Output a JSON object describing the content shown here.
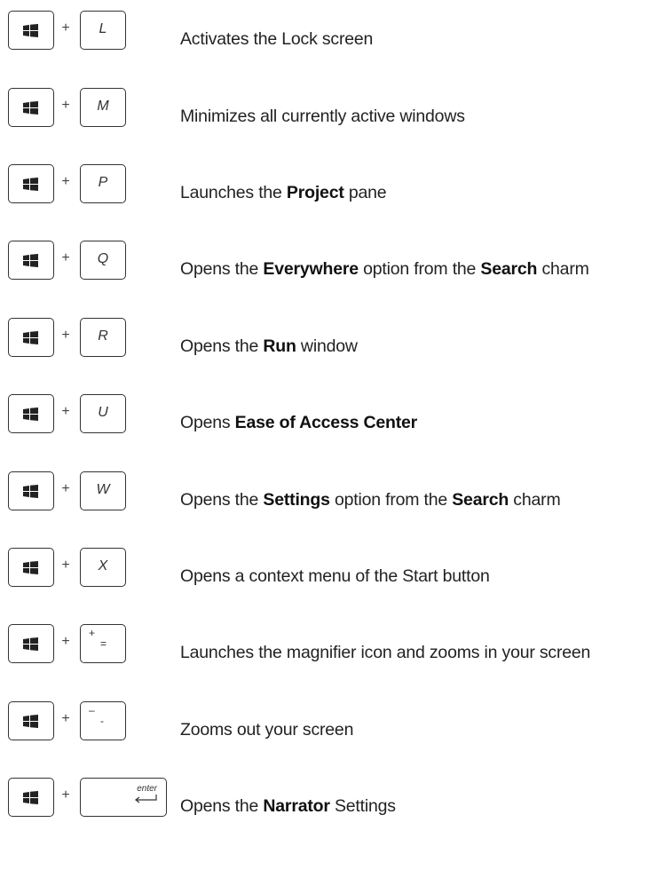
{
  "shortcuts": [
    {
      "key": "L",
      "plus": "+",
      "desc": [
        {
          "t": "Activates the Lock screen"
        }
      ]
    },
    {
      "key": "M",
      "plus": "+",
      "desc": [
        {
          "t": "Minimizes all currently active windows"
        }
      ]
    },
    {
      "key": "P",
      "plus": "+",
      "desc": [
        {
          "t": "Launches the "
        },
        {
          "t": "Project",
          "b": true
        },
        {
          "t": " pane"
        }
      ]
    },
    {
      "key": "Q",
      "plus": "+",
      "desc": [
        {
          "t": "Opens the "
        },
        {
          "t": "Everywhere",
          "b": true
        },
        {
          "t": " option from the "
        },
        {
          "t": "Search",
          "b": true
        },
        {
          "t": " charm"
        }
      ]
    },
    {
      "key": "R",
      "plus": "+",
      "desc": [
        {
          "t": "Opens the "
        },
        {
          "t": "Run",
          "b": true
        },
        {
          "t": " window"
        }
      ]
    },
    {
      "key": "U",
      "plus": "+",
      "desc": [
        {
          "t": "Opens "
        },
        {
          "t": "Ease of Access Center",
          "b": true
        }
      ]
    },
    {
      "key": "W",
      "plus": "+",
      "desc": [
        {
          "t": "Opens the "
        },
        {
          "t": "Settings",
          "b": true
        },
        {
          "t": " option from the "
        },
        {
          "t": "Search",
          "b": true
        },
        {
          "t": " charm"
        }
      ]
    },
    {
      "key": "X",
      "plus": "+",
      "desc": [
        {
          "t": "Opens a context menu of the Start button"
        }
      ]
    },
    {
      "key": "",
      "plus": "+",
      "sym_top": "+",
      "sym_bottom": "=",
      "desc": [
        {
          "t": "Launches the magnifier icon and zooms in your screen"
        }
      ]
    },
    {
      "key": "",
      "plus": "+",
      "sym_top": "–",
      "sym_bottom": "-",
      "desc": [
        {
          "t": "Zooms out your screen"
        }
      ]
    },
    {
      "key": "",
      "plus": "+",
      "enter": "enter",
      "desc": [
        {
          "t": "Opens the "
        },
        {
          "t": "Narrator",
          "b": true
        },
        {
          "t": " Settings"
        }
      ]
    }
  ]
}
